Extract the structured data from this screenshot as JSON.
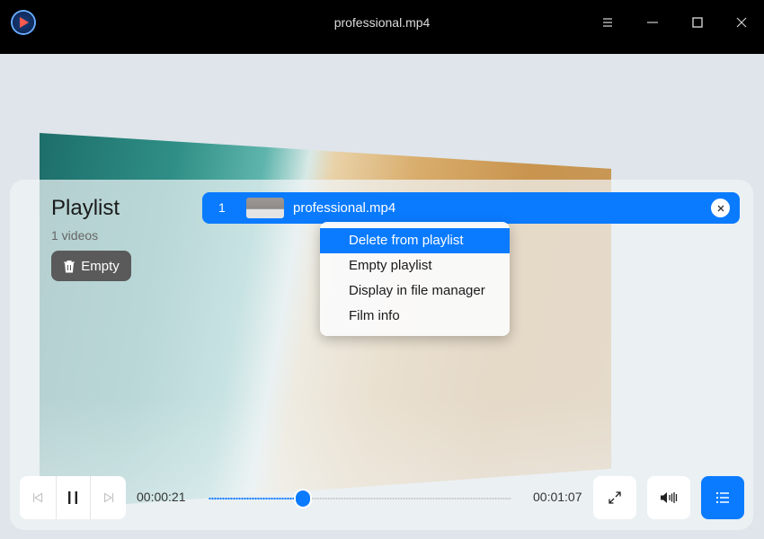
{
  "window": {
    "title": "professional.mp4"
  },
  "playlist": {
    "title": "Playlist",
    "count_label": "1 videos",
    "empty_label": "Empty",
    "items": [
      {
        "index": "1",
        "name": "professional.mp4"
      }
    ]
  },
  "context_menu": {
    "items": [
      {
        "label": "Delete from playlist",
        "active": true
      },
      {
        "label": "Empty playlist"
      },
      {
        "label": "Display in file manager"
      },
      {
        "label": "Film info"
      }
    ]
  },
  "player": {
    "current_time": "00:00:21",
    "total_time": "00:01:07",
    "progress_fraction": 0.313,
    "state": "playing"
  },
  "icons": {
    "app_logo": "player-logo-icon",
    "menu": "menu-icon",
    "minimize": "minimize-icon",
    "maximize": "maximize-icon",
    "close": "close-icon",
    "previous": "previous-icon",
    "pause": "pause-icon",
    "next": "next-icon",
    "fullscreen": "fullscreen-icon",
    "volume": "volume-icon",
    "playlist": "playlist-icon",
    "trash": "trash-icon"
  },
  "colors": {
    "accent": "#0a7bff",
    "titlebar": "#000000",
    "empty_button": "#5a5a5a"
  }
}
